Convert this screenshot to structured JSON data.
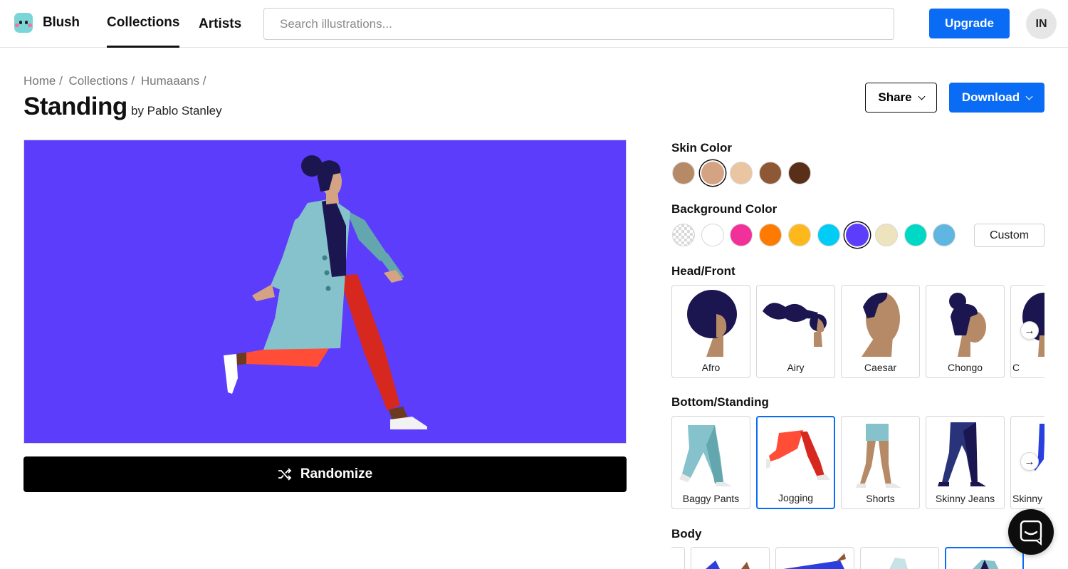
{
  "brand": {
    "name": "Blush"
  },
  "nav": {
    "tabs": [
      {
        "label": "Collections",
        "active": true
      },
      {
        "label": "Artists",
        "active": false
      }
    ]
  },
  "search": {
    "placeholder": "Search illustrations...",
    "value": ""
  },
  "header_actions": {
    "upgrade_label": "Upgrade",
    "avatar_initials": "IN"
  },
  "breadcrumb": [
    "Home /",
    "Collections /",
    "Humaaans /"
  ],
  "page": {
    "title": "Standing",
    "byline": "by Pablo Stanley",
    "share_label": "Share",
    "download_label": "Download"
  },
  "canvas": {
    "background_color": "#5b3dfb"
  },
  "randomize_label": "Randomize",
  "skin_color": {
    "title": "Skin Color",
    "options": [
      "#b68a66",
      "#d4a383",
      "#eac5a2",
      "#8e5735",
      "#5a2f18"
    ],
    "selected_index": 1
  },
  "background_color": {
    "title": "Background Color",
    "options": [
      "transparent",
      "#ffffff",
      "#f2309a",
      "#ff7a00",
      "#ffb81c",
      "#00cdf5",
      "#5b3dfb",
      "#ede3bc",
      "#00d8c6",
      "#5fb6e0"
    ],
    "selected_index": 6,
    "custom_label": "Custom"
  },
  "head_front": {
    "title": "Head/Front",
    "items": [
      "Afro",
      "Airy",
      "Caesar",
      "Chongo",
      "C"
    ]
  },
  "bottom_standing": {
    "title": "Bottom/Standing",
    "items": [
      "Baggy Pants",
      "Jogging",
      "Shorts",
      "Skinny Jeans",
      "Skinny"
    ],
    "selected_index": 1
  },
  "body": {
    "title": "Body"
  }
}
